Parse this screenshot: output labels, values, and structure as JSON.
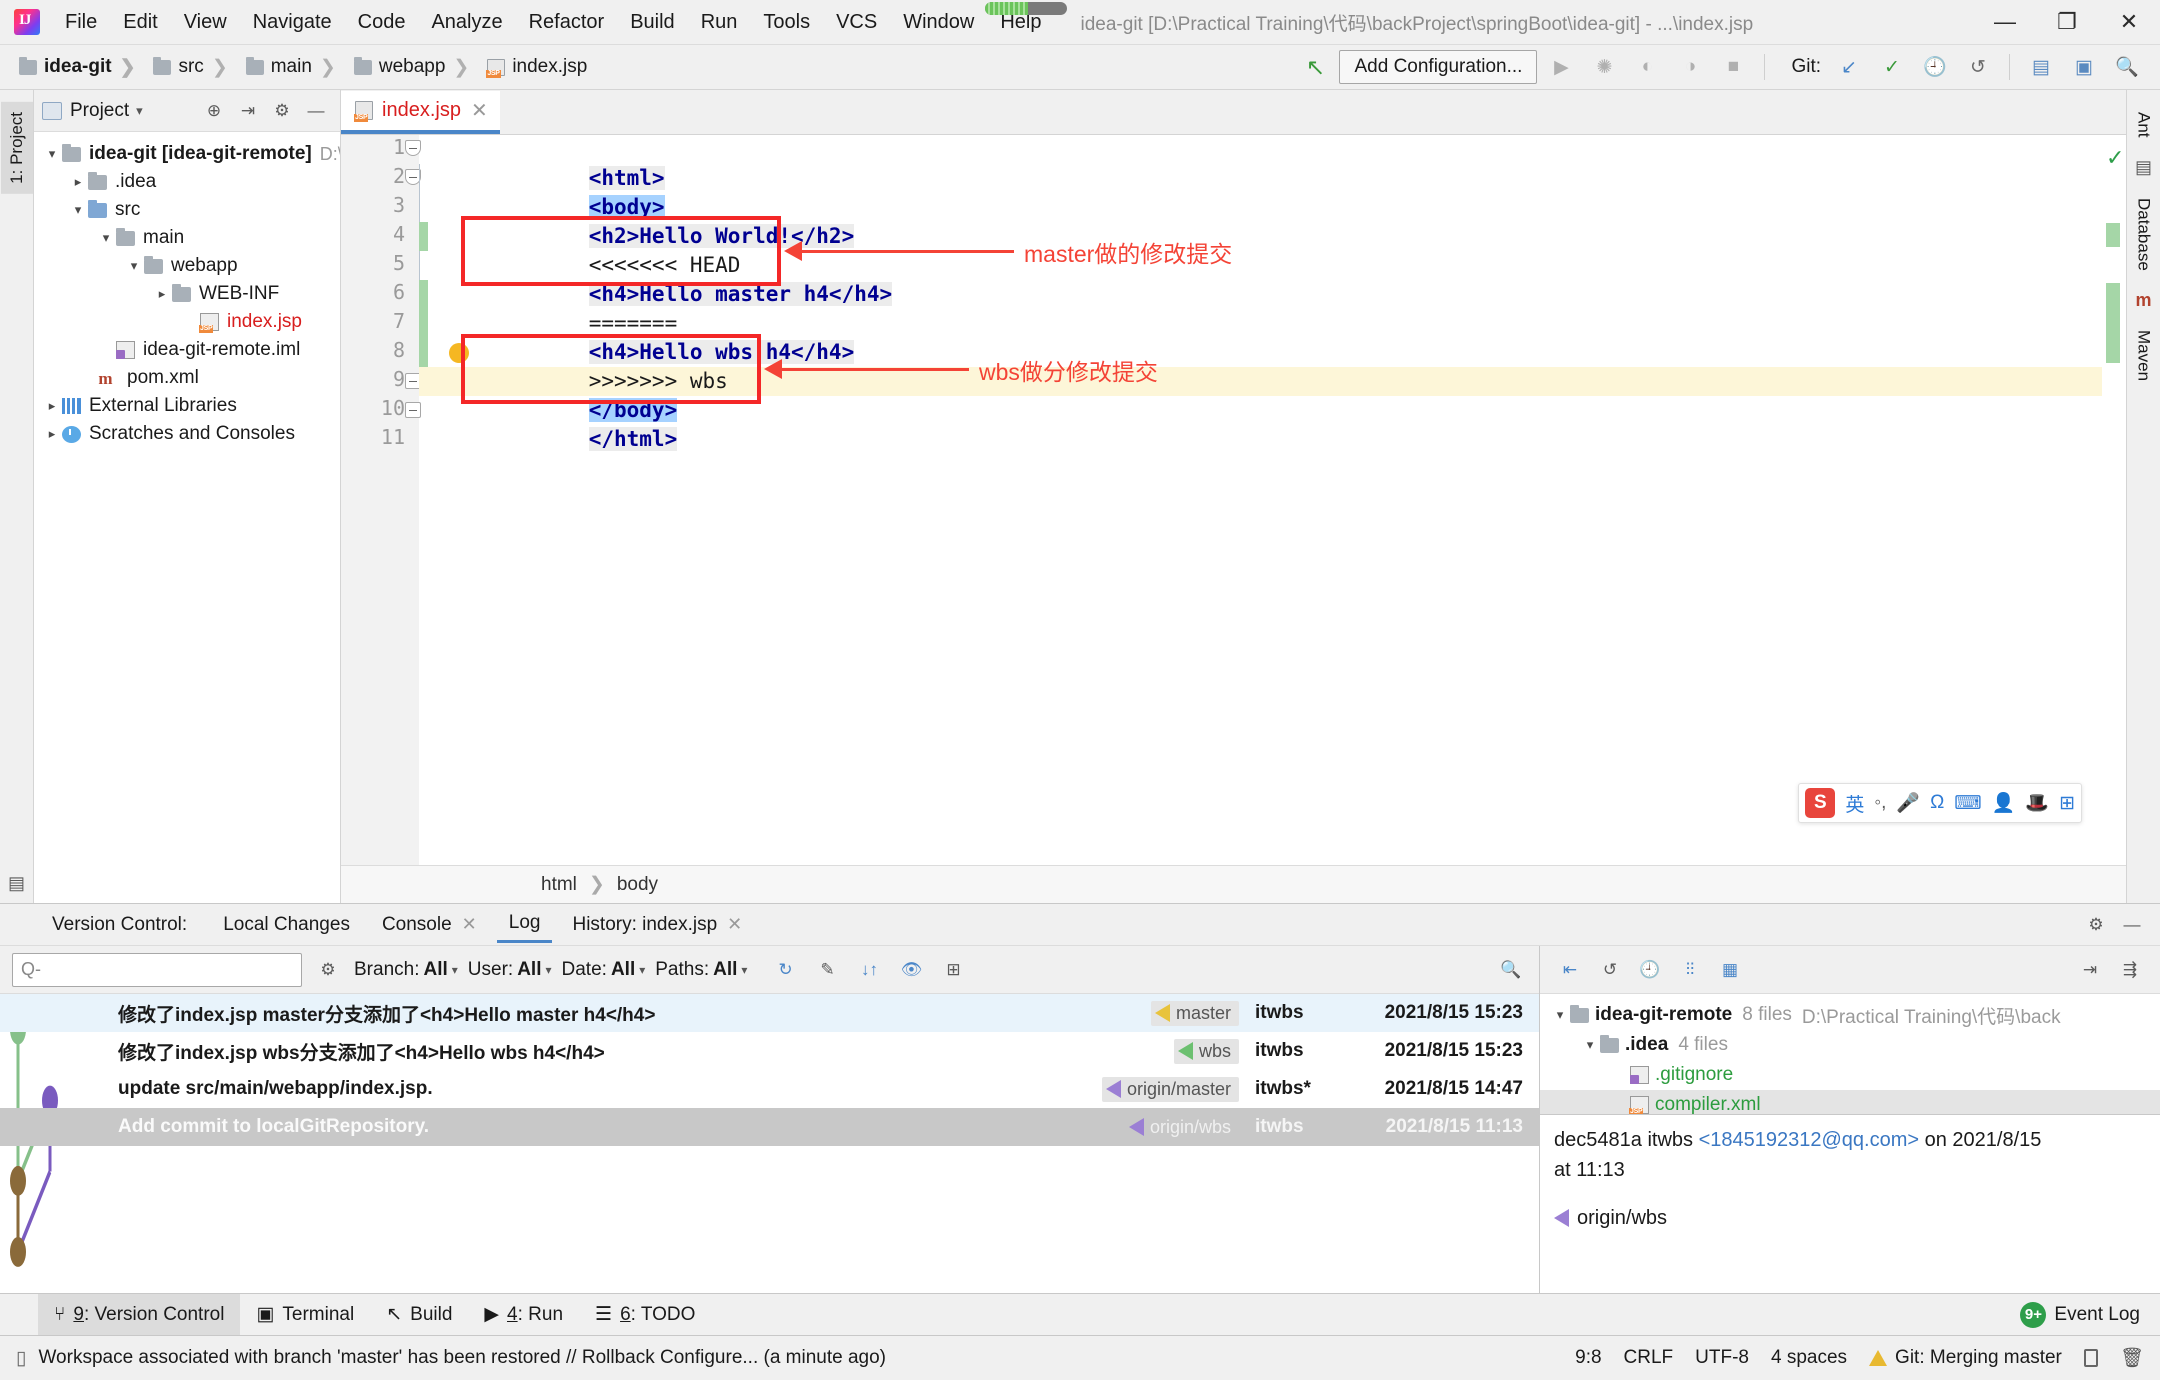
{
  "titlebar": {
    "window_title": "idea-git [D:\\Practical Training\\代码\\backProject\\springBoot\\idea-git] - ...\\index.jsp",
    "menus": [
      "File",
      "Edit",
      "View",
      "Navigate",
      "Code",
      "Analyze",
      "Refactor",
      "Build",
      "Run",
      "Tools",
      "VCS",
      "Window",
      "Help"
    ],
    "minimize": "—",
    "maximize": "❐",
    "close": "✕"
  },
  "navbar": {
    "breadcrumbs": [
      "idea-git",
      "src",
      "main",
      "webapp",
      "index.jsp"
    ],
    "add_configuration": "Add Configuration...",
    "git_label": "Git:",
    "run_icon": "▶",
    "debug_icon": "🐞",
    "coverage_icon": "▶",
    "profile_icon": "▶",
    "stop_icon": "■",
    "update_icon": "↙",
    "commit_icon": "✓",
    "history_icon": "🕘",
    "rollback_icon": "↺",
    "search_icon": "🔍"
  },
  "left_strip": {
    "tabs": [
      "1: Project"
    ]
  },
  "right_strip": {
    "tabs": [
      "Ant",
      "Database",
      "Maven"
    ]
  },
  "project_pane": {
    "title": "Project",
    "tree": [
      {
        "label": "idea-git [idea-git-remote]",
        "sub": "D:\\Prac",
        "bold": true,
        "depth": 0,
        "expanded": true,
        "icon": "folder"
      },
      {
        "label": ".idea",
        "depth": 1,
        "expanded": false,
        "icon": "folder"
      },
      {
        "label": "src",
        "depth": 1,
        "expanded": true,
        "icon": "folder-src"
      },
      {
        "label": "main",
        "depth": 2,
        "expanded": true,
        "icon": "folder"
      },
      {
        "label": "webapp",
        "depth": 3,
        "expanded": true,
        "icon": "folder"
      },
      {
        "label": "WEB-INF",
        "depth": 4,
        "expanded": false,
        "icon": "folder"
      },
      {
        "label": "index.jsp",
        "depth": 4,
        "expanded": null,
        "icon": "jsp",
        "red": true
      },
      {
        "label": "idea-git-remote.iml",
        "depth": 2,
        "expanded": null,
        "icon": "iml"
      },
      {
        "label": "pom.xml",
        "depth": 2,
        "expanded": null,
        "icon": "maven"
      },
      {
        "label": "External Libraries",
        "depth": 0,
        "expanded": false,
        "icon": "lib"
      },
      {
        "label": "Scratches and Consoles",
        "depth": 0,
        "expanded": false,
        "icon": "scratch"
      }
    ]
  },
  "editor": {
    "tab_name": "index.jsp",
    "tab_close": "✕",
    "lines": [
      {
        "n": 1,
        "text": "<html>"
      },
      {
        "n": 2,
        "text": "<body>"
      },
      {
        "n": 3,
        "text": "<h2>Hello World!</h2>"
      },
      {
        "n": 4,
        "text": "<<<<<<< HEAD"
      },
      {
        "n": 5,
        "text": "<h4>Hello master h4</h4>"
      },
      {
        "n": 6,
        "text": "======="
      },
      {
        "n": 7,
        "text": "<h4>Hello wbs h4</h4>"
      },
      {
        "n": 8,
        "text": ">>>>>>> wbs"
      },
      {
        "n": 9,
        "text": "</body>"
      },
      {
        "n": 10,
        "text": "</html>"
      },
      {
        "n": 11,
        "text": ""
      }
    ],
    "breadcrumb": [
      "html",
      "body"
    ],
    "annotations": [
      {
        "text": "master做的修改提交"
      },
      {
        "text": "wbs做分修改提交"
      }
    ]
  },
  "ime": {
    "logo": "S",
    "lang": "英",
    "items": [
      "◦,",
      "🎤",
      "Ω",
      "⌨",
      "👤",
      "🎩",
      "⊞"
    ]
  },
  "vcs": {
    "panel_title": "Version Control:",
    "tabs": [
      {
        "label": "Local Changes",
        "closable": false,
        "selected": false
      },
      {
        "label": "Console",
        "closable": true,
        "selected": false
      },
      {
        "label": "Log",
        "closable": false,
        "selected": true
      },
      {
        "label": "History: index.jsp",
        "closable": true,
        "selected": false
      }
    ],
    "settings_icon": "⚙",
    "minimize_icon": "—",
    "toolbar": {
      "search_placeholder": "Q-",
      "filters": [
        {
          "label": "Branch:",
          "value": "All"
        },
        {
          "label": "User:",
          "value": "All"
        },
        {
          "label": "Date:",
          "value": "All"
        },
        {
          "label": "Paths:",
          "value": "All"
        }
      ],
      "icons": [
        "↻",
        "✎",
        "↓↑",
        "👁",
        "⊞",
        "🔍"
      ]
    },
    "commits": [
      {
        "message": "修改了index.jsp master分支添加了<h4>Hello master h4</h4>",
        "branch": "master",
        "branch_color": "#e8c33c",
        "author": "itwbs",
        "date": "2021/8/15 15:23",
        "state": "selected"
      },
      {
        "message": "修改了index.jsp wbs分支添加了<h4>Hello wbs h4</h4>",
        "branch": "wbs",
        "branch_color": "#6cc070",
        "author": "itwbs",
        "date": "2021/8/15 15:23",
        "state": "normal"
      },
      {
        "message": "update src/main/webapp/index.jsp.",
        "branch": "origin/master",
        "branch_color": "#9b7fd4",
        "author": "itwbs*",
        "date": "2021/8/15 14:47",
        "state": "normal"
      },
      {
        "message": "Add commit to localGitRepository.",
        "branch": "origin/wbs",
        "branch_color": "#9b7fd4",
        "author": "itwbs",
        "date": "2021/8/15 11:13",
        "state": "greyed"
      }
    ],
    "detail_toolbar_icons": [
      "⇤",
      "↺",
      "🕘",
      "⫶⫶",
      "▦",
      "⇥",
      "⇶"
    ],
    "file_tree": [
      {
        "label": "idea-git-remote",
        "meta": "8 files",
        "path": "D:\\Practical Training\\代码\\back",
        "depth": 0,
        "expanded": true,
        "icon": "repo"
      },
      {
        "label": ".idea",
        "meta": "4 files",
        "depth": 1,
        "expanded": true,
        "icon": "folder"
      },
      {
        "label": ".gitignore",
        "depth": 2,
        "icon": "ignored",
        "green": true
      },
      {
        "label": "compiler.xml",
        "depth": 2,
        "icon": "xml",
        "green": true,
        "selected": true
      }
    ],
    "commit_detail": {
      "hash": "dec5481a",
      "author": "itwbs",
      "email": "<1845192312@qq.com>",
      "on_label": "on 2021/8/15",
      "time_label": "at 11:13",
      "branch": "origin/wbs"
    }
  },
  "toolwindows": {
    "tabs": [
      {
        "num": "9",
        "label": ": Version Control",
        "icon": "⑂",
        "selected": true
      },
      {
        "num": "",
        "label": "Terminal",
        "icon": "▣",
        "selected": false
      },
      {
        "num": "",
        "label": "Build",
        "icon": "🔨",
        "selected": false
      },
      {
        "num": "4",
        "label": ": Run",
        "icon": "▶",
        "selected": false
      },
      {
        "num": "6",
        "label": ": TODO",
        "icon": "☰",
        "selected": false
      }
    ],
    "event_log": "Event Log",
    "event_badge": "9+"
  },
  "statusbar": {
    "message": "Workspace associated with branch 'master' has been restored // Rollback  Configure... (a minute ago)",
    "caret": "9:8",
    "line_sep": "CRLF",
    "encoding": "UTF-8",
    "indent": "4 spaces",
    "git_status": "Git: Merging master"
  }
}
